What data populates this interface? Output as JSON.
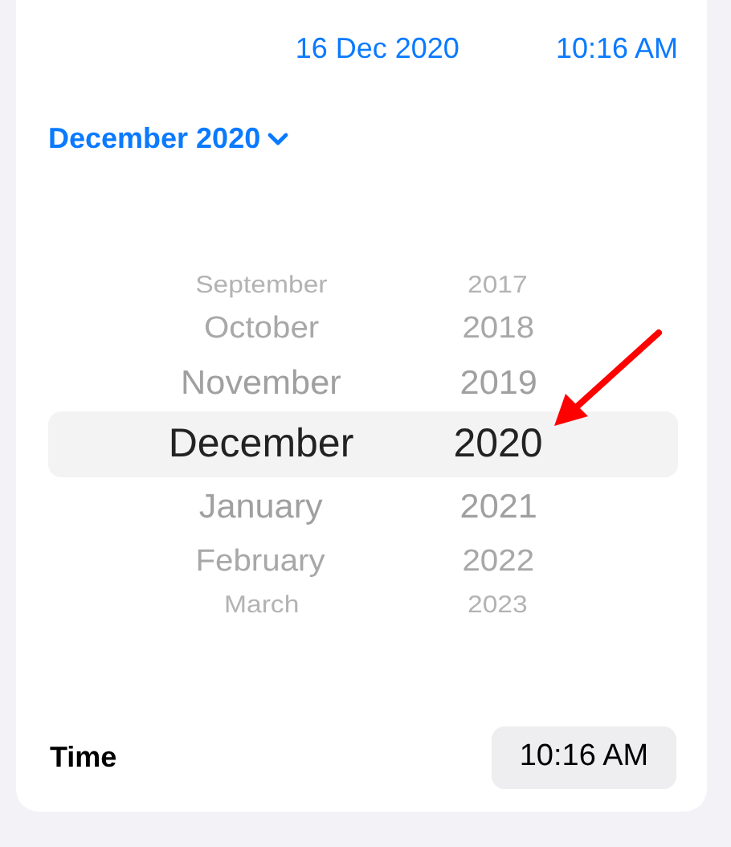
{
  "header": {
    "date": "16 Dec 2020",
    "time": "10:16 AM"
  },
  "month_selector": {
    "label": "December 2020",
    "expanded": true
  },
  "picker": {
    "rows": [
      {
        "month": "September",
        "year": "2017",
        "selected": false
      },
      {
        "month": "October",
        "year": "2018",
        "selected": false
      },
      {
        "month": "November",
        "year": "2019",
        "selected": false
      },
      {
        "month": "December",
        "year": "2020",
        "selected": true
      },
      {
        "month": "January",
        "year": "2021",
        "selected": false
      },
      {
        "month": "February",
        "year": "2022",
        "selected": false
      },
      {
        "month": "March",
        "year": "2023",
        "selected": false
      }
    ]
  },
  "time_row": {
    "label": "Time",
    "value": "10:16 AM"
  }
}
